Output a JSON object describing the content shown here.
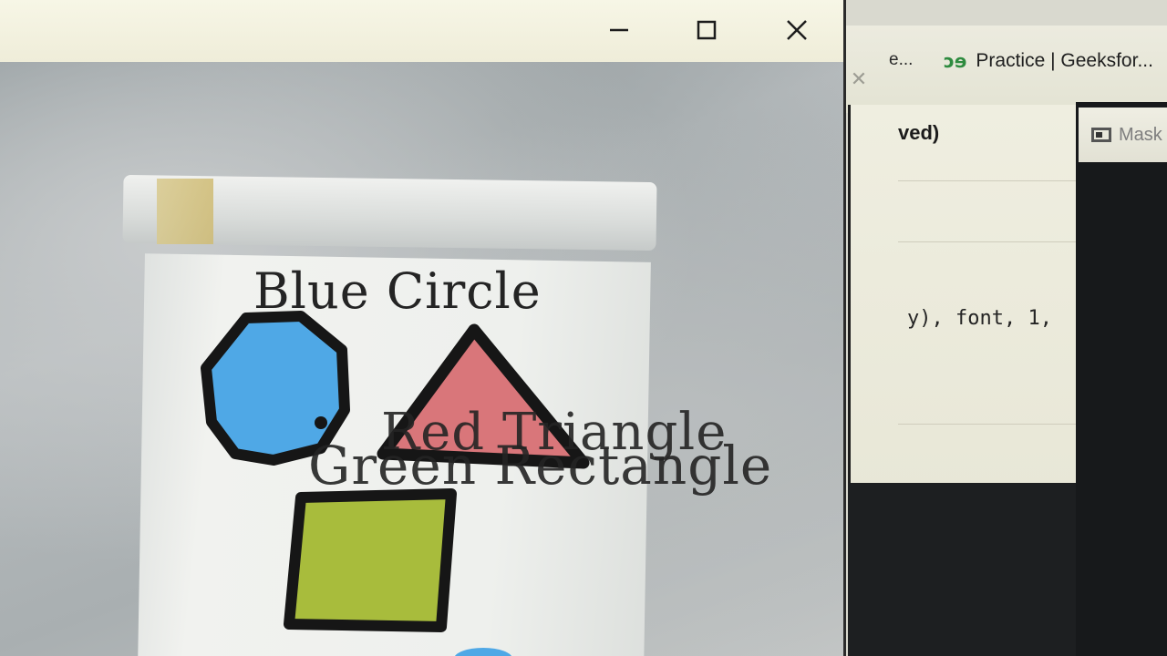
{
  "background_browser": {
    "tab_partial_text": "e...",
    "tab_title": "Practice | Geeksfor...",
    "tab_icon": "geeksforgeeks-icon",
    "editor_title_fragment": "ved)",
    "code_fragment": "y), font, 1,",
    "right_window_tab": "Mask"
  },
  "window": {
    "buttons": [
      "minimize",
      "maximize",
      "close"
    ]
  },
  "canvas": {
    "labels": {
      "blue_circle": "Blue Circle",
      "red_triangle": "Red Triangle",
      "green_rectangle": "Green Rectangle"
    },
    "shape_colors": {
      "circle": "#4fa8e6",
      "triangle": "#d9767a",
      "rectangle": "#a8bc3c",
      "outline": "#161616"
    }
  }
}
